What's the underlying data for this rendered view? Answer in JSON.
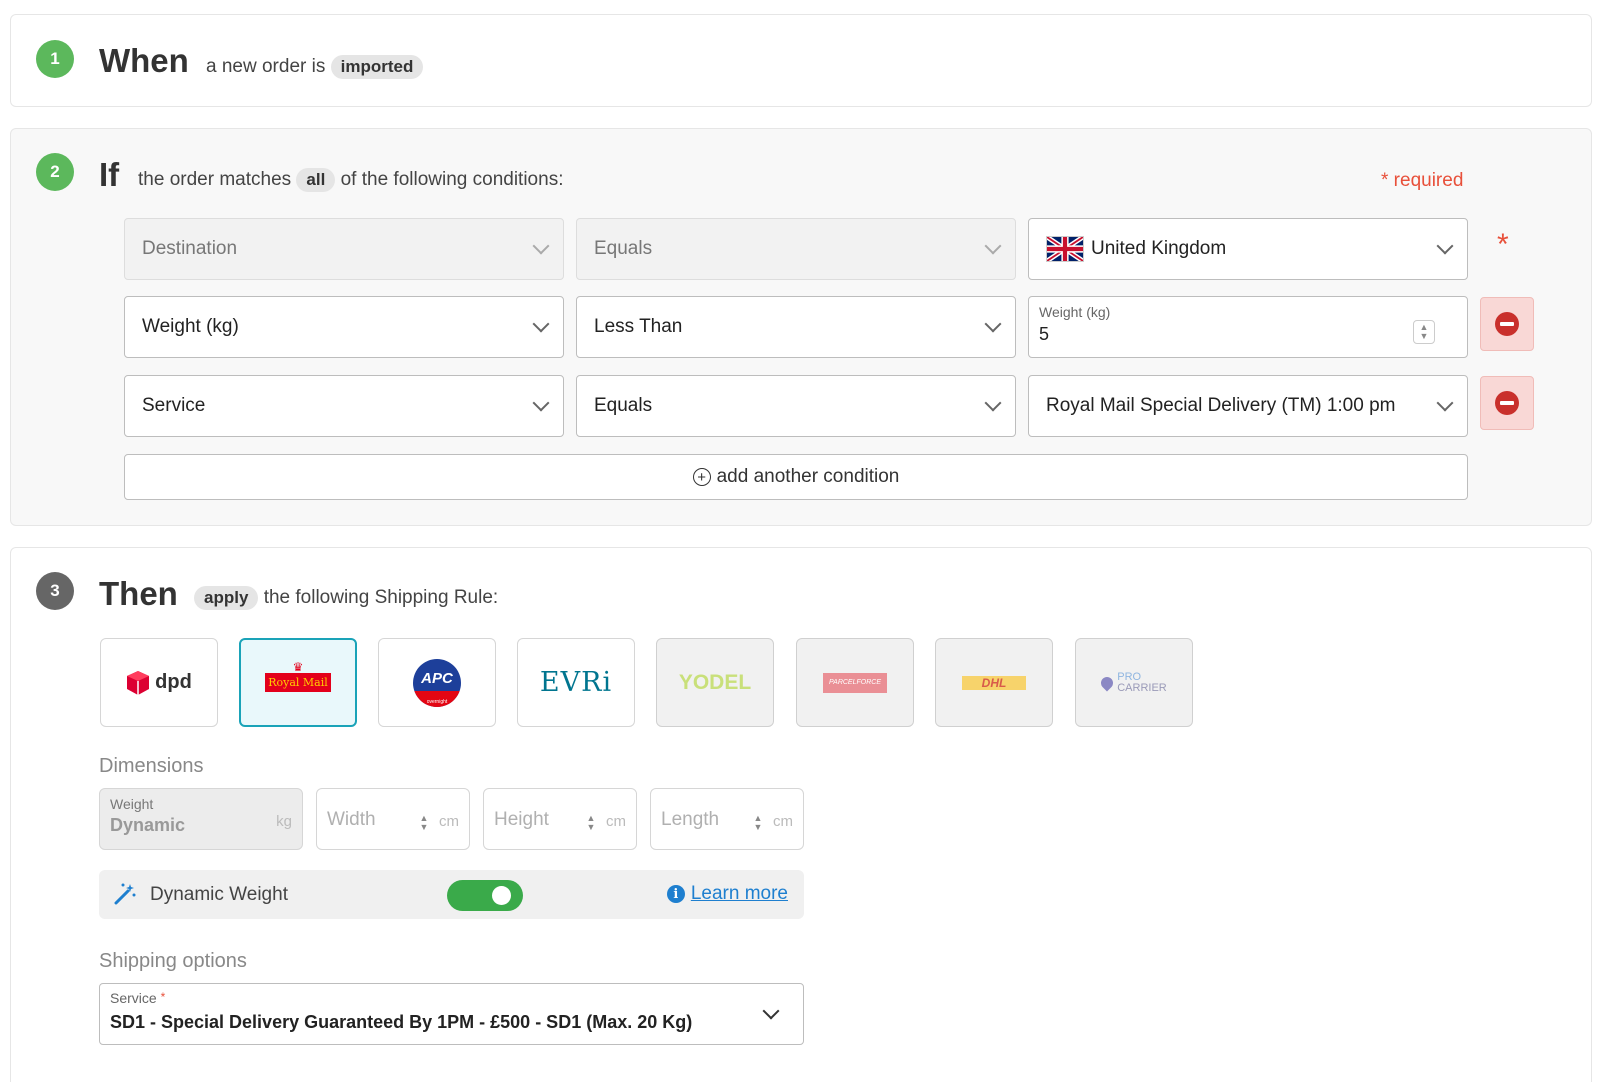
{
  "when": {
    "step": "1",
    "title": "When",
    "text": "a new order is",
    "pill": "imported"
  },
  "if": {
    "step": "2",
    "title": "If",
    "text_before": "the order matches",
    "pill": "all",
    "text_after": "of the following conditions:",
    "required": "* required",
    "conditions": [
      {
        "field": "Destination",
        "operator": "Equals",
        "value": "United Kingdom",
        "flag": "uk-flag-icon"
      },
      {
        "field": "Weight (kg)",
        "operator": "Less Than",
        "value_label": "Weight (kg)",
        "value": "5"
      },
      {
        "field": "Service",
        "operator": "Equals",
        "value": "Royal Mail Special Delivery (TM) 1:00 pm"
      }
    ],
    "row_required_mark": "*",
    "add_condition": "add another condition"
  },
  "then": {
    "step": "3",
    "title": "Then",
    "pill": "apply",
    "text": "the following Shipping Rule:",
    "carriers": [
      {
        "name": "dpd",
        "icon": "dpd-logo"
      },
      {
        "name": "Royal Mail",
        "icon": "royal-mail-logo",
        "selected": true
      },
      {
        "name": "APC",
        "icon": "apc-logo",
        "sub": "overnight"
      },
      {
        "name": "EVRi",
        "icon": "evri-logo"
      },
      {
        "name": "YODEL",
        "icon": "yodel-logo"
      },
      {
        "name": "PARCELFORCE",
        "icon": "parcelforce-logo"
      },
      {
        "name": "DHL",
        "icon": "dhl-logo"
      },
      {
        "name": "PRO",
        "name2": "CARRIER",
        "icon": "pro-carrier-logo"
      }
    ],
    "dimensions": {
      "label": "Dimensions",
      "weight_label": "Weight",
      "weight_value": "Dynamic",
      "weight_unit": "kg",
      "width_placeholder": "Width",
      "height_placeholder": "Height",
      "length_placeholder": "Length",
      "unit": "cm"
    },
    "dynamic_weight": {
      "label": "Dynamic Weight",
      "enabled": true,
      "learn_more": "Learn more"
    },
    "shipping_options": {
      "label": "Shipping options",
      "service_label": "Service",
      "service_required": "*",
      "service_value": "SD1 - Special Delivery Guaranteed By 1PM - £500 - SD1 (Max. 20 Kg)"
    }
  },
  "colors": {
    "step_green": "#5cb85c",
    "step_gray": "#666666",
    "required_red": "#e8503a",
    "selected_carrier": "#1aa3b8",
    "toggle_green": "#3aaa4a",
    "link_blue": "#1e7fcf"
  }
}
